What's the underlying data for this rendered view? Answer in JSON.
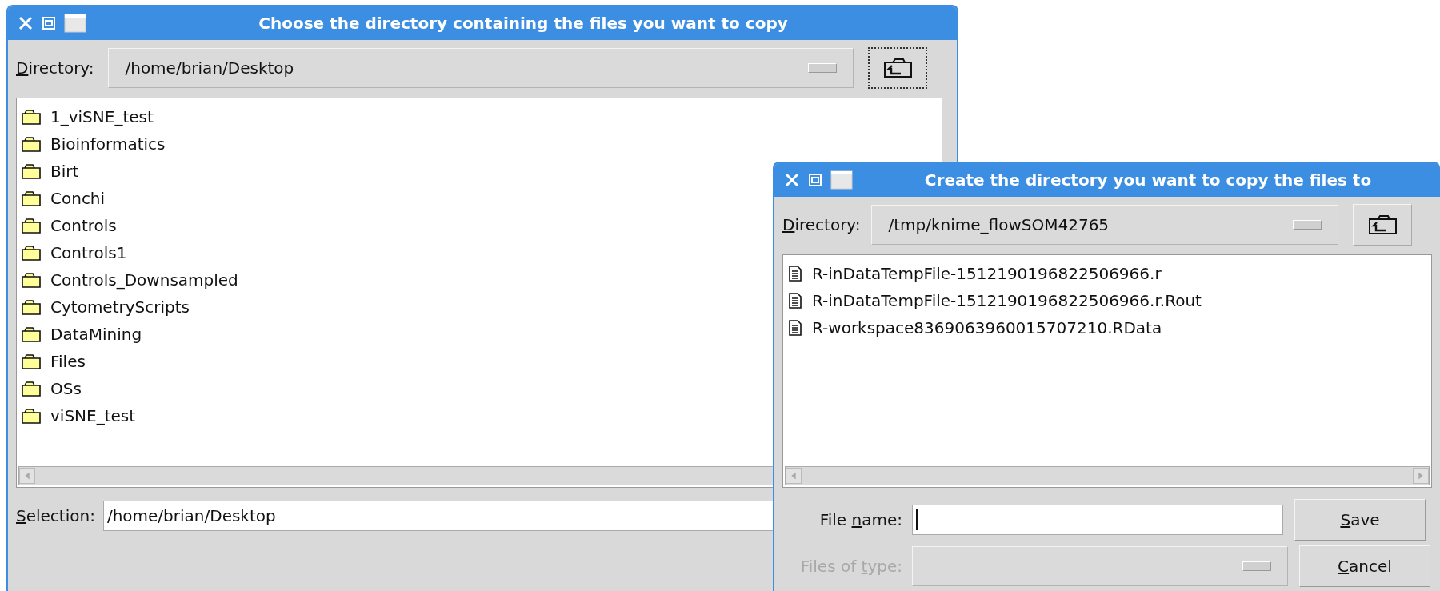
{
  "chooser": {
    "title": "Choose the directory containing the files you want to copy",
    "directory": {
      "label": {
        "key": "D",
        "after": "irectory:"
      },
      "value": "/home/brian/Desktop"
    },
    "up_button": {
      "focused": true
    },
    "items": [
      {
        "name": "1_viSNE_test",
        "kind": "folder"
      },
      {
        "name": "Bioinformatics",
        "kind": "folder"
      },
      {
        "name": "Birt",
        "kind": "folder"
      },
      {
        "name": "Conchi",
        "kind": "folder"
      },
      {
        "name": "Controls",
        "kind": "folder"
      },
      {
        "name": "Controls1",
        "kind": "folder"
      },
      {
        "name": "Controls_Downsampled",
        "kind": "folder"
      },
      {
        "name": "CytometryScripts",
        "kind": "folder"
      },
      {
        "name": "DataMining",
        "kind": "folder"
      },
      {
        "name": "Files",
        "kind": "folder"
      },
      {
        "name": "OSs",
        "kind": "folder"
      },
      {
        "name": "viSNE_test",
        "kind": "folder"
      }
    ],
    "selection": {
      "label": {
        "key": "S",
        "after": "election:"
      },
      "value": "/home/brian/Desktop"
    }
  },
  "creator": {
    "title": "Create the directory you want to copy the files to",
    "directory": {
      "label": {
        "key": "D",
        "after": "irectory:"
      },
      "value": "/tmp/knime_flowSOM42765"
    },
    "up_button": {
      "focused": false
    },
    "items": [
      {
        "name": "R-inDataTempFile-1512190196822506966.r",
        "kind": "file"
      },
      {
        "name": "R-inDataTempFile-1512190196822506966.r.Rout",
        "kind": "file"
      },
      {
        "name": "R-workspace8369063960015707210.RData",
        "kind": "file"
      }
    ],
    "file_name": {
      "label": {
        "before": "File ",
        "key": "n",
        "after": "ame:"
      },
      "focused": true
    },
    "files_of_type": {
      "label": {
        "before": "Files of ",
        "key": "t",
        "after": "ype:"
      },
      "disabled": true
    },
    "buttons": [
      {
        "label": {
          "key": "S",
          "after": "ave"
        }
      },
      {
        "label": {
          "key": "C",
          "after": "ancel"
        }
      }
    ]
  }
}
